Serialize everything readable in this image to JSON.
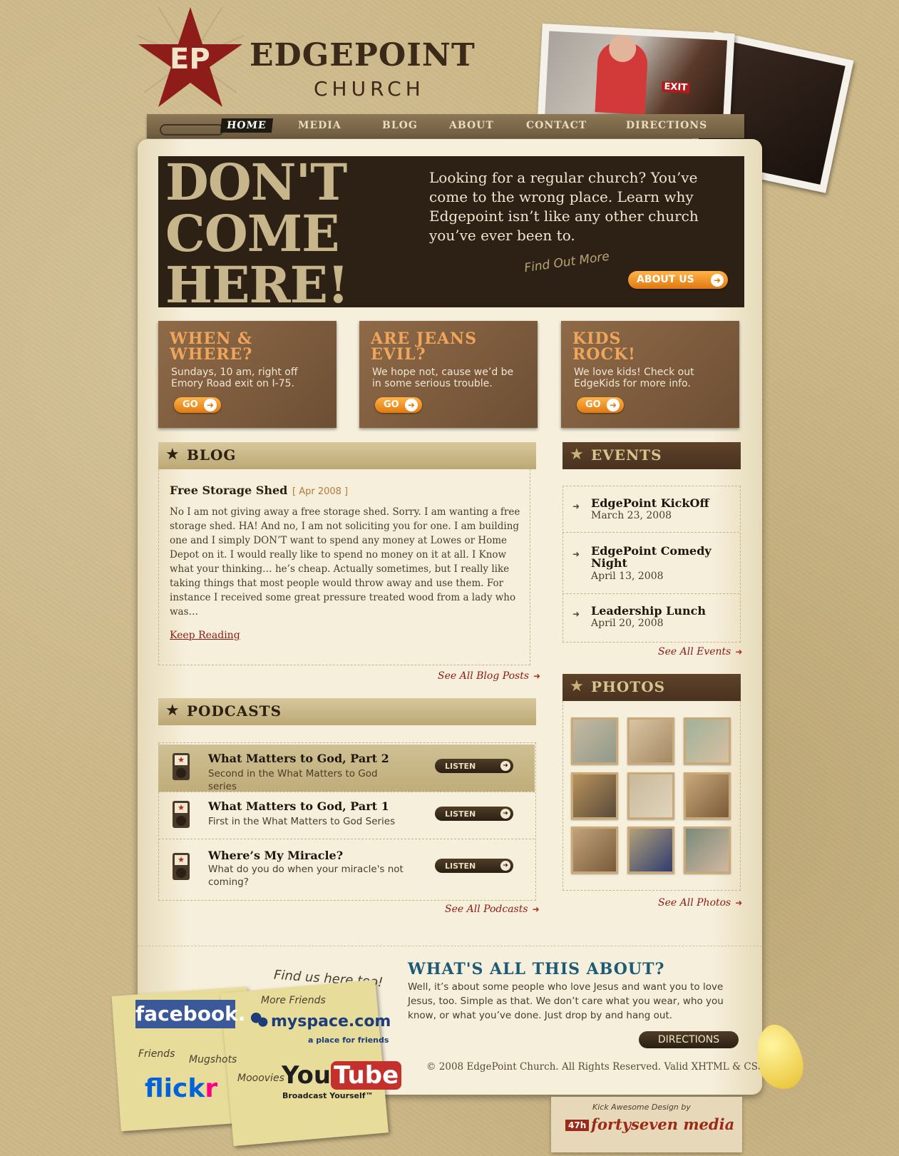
{
  "brand": {
    "initials": "EP",
    "name": "EDGEPOINT",
    "sub": "CHURCH"
  },
  "photo_exit_sign": "EXIT",
  "nav": {
    "items": [
      "HOME",
      "MEDIA",
      "BLOG",
      "ABOUT",
      "CONTACT",
      "DIRECTIONS"
    ],
    "active": "HOME"
  },
  "hero": {
    "headline": "DON'T COME HERE!",
    "text": "Looking for a regular church? You’ve come to the wrong place. Learn why Edgepoint isn’t like any other church you’ve ever been to.",
    "find_out": "Find Out More",
    "button": "ABOUT US"
  },
  "promos": [
    {
      "title": "WHEN & WHERE?",
      "desc": "Sundays, 10 am, right off Emory Road exit on I-75.",
      "button": "GO"
    },
    {
      "title": "ARE JEANS EVIL?",
      "desc": "We hope not, cause we’d be in some serious trouble.",
      "button": "GO"
    },
    {
      "title": "KIDS ROCK!",
      "desc": "We love kids! Check out EdgeKids for more info.",
      "button": "GO"
    }
  ],
  "blog": {
    "header": "BLOG",
    "post_title": "Free Storage Shed",
    "post_date": "[ Apr 2008 ]",
    "body": "No I am not giving away a free storage shed.  Sorry.  I am wanting a free storage shed.  HA!  And no, I am not soliciting you for one.  I am building one and I simply DON’T want to spend any money at Lowes or Home Depot on it. I would really like to spend no money on it at all.  I Know what your thinking… he’s cheap.  Actually sometimes, but I really like taking things that most people would throw away and use them.  For instance I received some great pressure treated wood from a lady who was…",
    "read_more": "Keep Reading",
    "see_all": "See All Blog Posts"
  },
  "podcasts": {
    "header": "PODCASTS",
    "items": [
      {
        "title": "What Matters to God, Part 2",
        "desc": "Second in the What Matters to God series",
        "button": "LISTEN"
      },
      {
        "title": "What Matters to God, Part 1",
        "desc": "First in the What Matters to God Series",
        "button": "LISTEN"
      },
      {
        "title": "Where’s My Miracle?",
        "desc": "What do you do when your miracle's not coming?",
        "button": "LISTEN"
      }
    ],
    "see_all": "See All Podcasts"
  },
  "events": {
    "header": "EVENTS",
    "items": [
      {
        "title": "EdgePoint KickOff",
        "date": "March 23, 2008"
      },
      {
        "title": "EdgePoint Comedy Night",
        "date": "April 13, 2008"
      },
      {
        "title": "Leadership Lunch",
        "date": "April 20, 2008"
      }
    ],
    "see_all": "See All Events"
  },
  "photos": {
    "header": "PHOTOS",
    "see_all": "See All Photos"
  },
  "about": {
    "title": "WHAT'S ALL THIS ABOUT?",
    "text": "Well, it’s about some people who love Jesus and want you to love Jesus, too. Simple as that. We don’t care what you wear, who you know, or what you’ve done. Just drop by and hang out.",
    "button": "DIRECTIONS",
    "copyright": "© 2008 EdgePoint Church. All Rights Reserved. Valid XHTML & CSS."
  },
  "social": {
    "find_us": "Find us here too!",
    "facebook": "facebook.",
    "facebook_note": "Friends",
    "flickr_a": "flick",
    "flickr_b": "r",
    "flickr_note": "Mugshots",
    "myspace_note": "More Friends",
    "myspace": "myspace.com",
    "myspace_tag": "a place for friends",
    "youtube_note": "Mooovies",
    "youtube_a": "You",
    "youtube_b": "Tube",
    "youtube_tag": "Broadcast Yourself™"
  },
  "credit": {
    "line1": "Kick Awesome Design by",
    "badge": "47h",
    "name": "fortyseven media"
  },
  "colors": {
    "accent_orange": "#e07a10",
    "dark_brown": "#2c2114",
    "link_red": "#8c1a12",
    "about_blue": "#1d5a75"
  }
}
